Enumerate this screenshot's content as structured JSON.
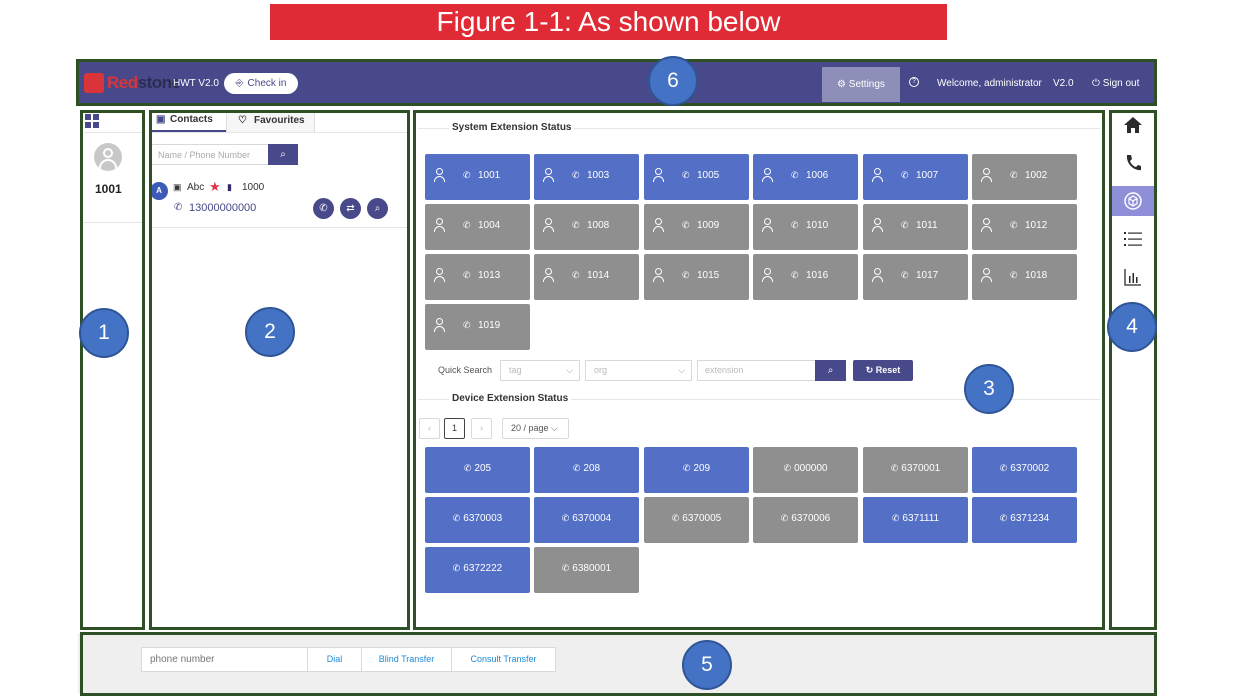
{
  "figure_title": "Figure 1-1: As shown below",
  "markers": [
    "1",
    "2",
    "3",
    "4",
    "5",
    "6"
  ],
  "header": {
    "logo_red": "Red",
    "logo_dark": "stone",
    "app_version": "HWT V2.0",
    "checkin_label": "Check in",
    "settings_label": "Settings",
    "welcome": "Welcome,  administrator",
    "version": "V2.0",
    "signout_label": "Sign out"
  },
  "agent": {
    "extension": "1001"
  },
  "contacts": {
    "tabs": [
      "Contacts",
      "Favourites"
    ],
    "search_placeholder": "Name / Phone Number",
    "items": [
      {
        "initial": "A",
        "name": "Abc",
        "extension": "1000",
        "phone": "13000000000"
      }
    ]
  },
  "system_status": {
    "title": "System Extension Status",
    "tiles": [
      {
        "ext": "1001",
        "state": "blue"
      },
      {
        "ext": "1003",
        "state": "blue"
      },
      {
        "ext": "1005",
        "state": "blue"
      },
      {
        "ext": "1006",
        "state": "blue"
      },
      {
        "ext": "1007",
        "state": "blue"
      },
      {
        "ext": "1002",
        "state": "gray"
      },
      {
        "ext": "1004",
        "state": "gray"
      },
      {
        "ext": "1008",
        "state": "gray"
      },
      {
        "ext": "1009",
        "state": "gray"
      },
      {
        "ext": "1010",
        "state": "gray"
      },
      {
        "ext": "1011",
        "state": "gray"
      },
      {
        "ext": "1012",
        "state": "gray"
      },
      {
        "ext": "1013",
        "state": "gray"
      },
      {
        "ext": "1014",
        "state": "gray"
      },
      {
        "ext": "1015",
        "state": "gray"
      },
      {
        "ext": "1016",
        "state": "gray"
      },
      {
        "ext": "1017",
        "state": "gray"
      },
      {
        "ext": "1018",
        "state": "gray"
      },
      {
        "ext": "1019",
        "state": "gray"
      }
    ]
  },
  "quick_search": {
    "label": "Quick Search",
    "tag_placeholder": "tag",
    "org_placeholder": "org",
    "extension_placeholder": "extension",
    "reset_label": "Reset"
  },
  "device_status": {
    "title": "Device Extension Status",
    "current_page": "1",
    "page_size": "20 / page",
    "tiles": [
      {
        "ext": "205",
        "state": "blue"
      },
      {
        "ext": "208",
        "state": "blue"
      },
      {
        "ext": "209",
        "state": "blue"
      },
      {
        "ext": "000000",
        "state": "gray"
      },
      {
        "ext": "6370001",
        "state": "gray"
      },
      {
        "ext": "6370002",
        "state": "blue"
      },
      {
        "ext": "6370003",
        "state": "blue"
      },
      {
        "ext": "6370004",
        "state": "blue"
      },
      {
        "ext": "6370005",
        "state": "gray"
      },
      {
        "ext": "6370006",
        "state": "gray"
      },
      {
        "ext": "6371111",
        "state": "blue"
      },
      {
        "ext": "6371234",
        "state": "blue"
      },
      {
        "ext": "6372222",
        "state": "blue"
      },
      {
        "ext": "6380001",
        "state": "gray"
      }
    ]
  },
  "dialer": {
    "placeholder": "phone number",
    "dial_label": "Dial",
    "blind_transfer_label": "Blind Transfer",
    "consult_transfer_label": "Consult Transfer"
  },
  "right_nav": [
    "home-icon",
    "phone-icon",
    "cube-icon",
    "list-icon",
    "bar-chart-icon"
  ],
  "colors": {
    "banner": "#e02a35",
    "header": "#48498a",
    "online": "#5470c6",
    "offline": "#8f8f8f",
    "marker": "#4472c4",
    "frame": "#2f4f24"
  }
}
